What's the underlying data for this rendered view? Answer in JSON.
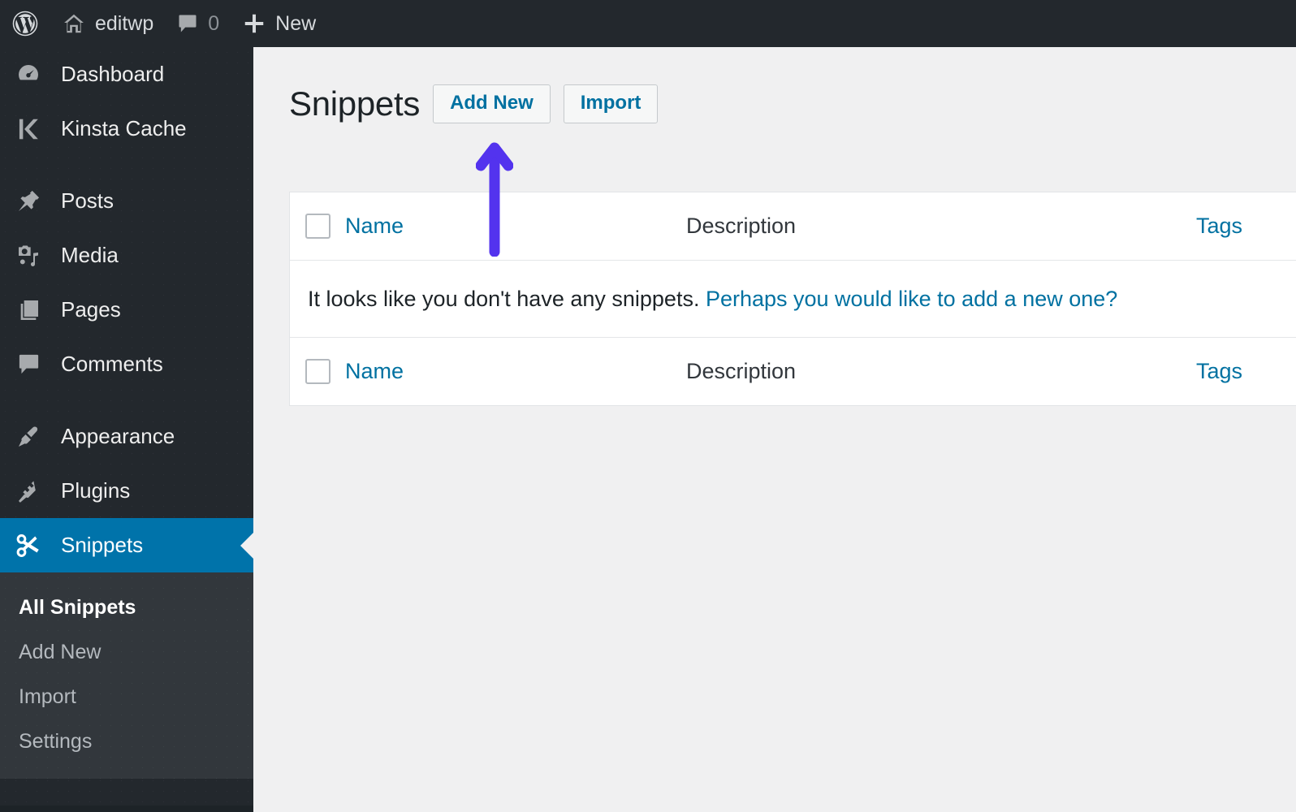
{
  "adminbar": {
    "wp_logo": "wordpress-logo",
    "site_name": "editwp",
    "comments_count": "0",
    "new_label": "New"
  },
  "sidebar": {
    "items": [
      {
        "label": "Dashboard",
        "icon": "dashboard-icon"
      },
      {
        "label": "Kinsta Cache",
        "icon": "kinsta-k-icon"
      },
      {
        "label": "Posts",
        "icon": "pin-icon"
      },
      {
        "label": "Media",
        "icon": "media-icon"
      },
      {
        "label": "Pages",
        "icon": "pages-icon"
      },
      {
        "label": "Comments",
        "icon": "comment-bubble-icon"
      },
      {
        "label": "Appearance",
        "icon": "paintbrush-icon"
      },
      {
        "label": "Plugins",
        "icon": "plug-icon"
      },
      {
        "label": "Snippets",
        "icon": "scissors-icon"
      }
    ],
    "submenu": [
      {
        "label": "All Snippets",
        "current": true
      },
      {
        "label": "Add New",
        "current": false
      },
      {
        "label": "Import",
        "current": false
      },
      {
        "label": "Settings",
        "current": false
      }
    ]
  },
  "header": {
    "title": "Snippets",
    "add_new_label": "Add New",
    "import_label": "Import"
  },
  "table": {
    "columns": {
      "name": "Name",
      "description": "Description",
      "tags": "Tags"
    },
    "empty_message": "It looks like you don't have any snippets. ",
    "empty_link": "Perhaps you would like to add a new one?"
  },
  "annotation": {
    "arrow_color": "#5333ee",
    "points_at": "add-new-button"
  },
  "colors": {
    "admin_bar": "#23282d",
    "sidebar": "#23282d",
    "submenu": "#32373c",
    "current_menu": "#0073aa",
    "content_bg": "#f0f0f1",
    "link": "#0071a1",
    "arrow": "#5333ee"
  }
}
